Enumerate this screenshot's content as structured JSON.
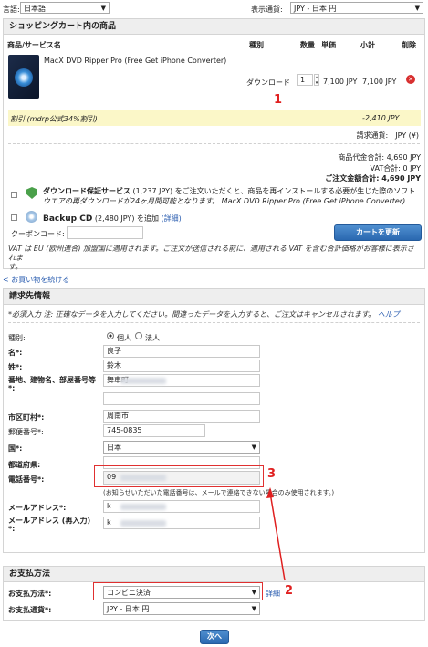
{
  "top": {
    "language_label": "言語:",
    "language_value": "日本語",
    "currency_label": "表示通貨:",
    "currency_value": "JPY - 日本 円"
  },
  "cart": {
    "title": "ショッピングカート内の商品",
    "col_product": "商品/サービス名",
    "col_type": "種別",
    "col_qty": "数量",
    "col_price": "単価",
    "col_subtotal": "小計",
    "col_delete": "削除",
    "product_name": "MacX DVD Ripper Pro (Free Get iPhone Converter)",
    "product_type": "ダウンロード",
    "product_qty": "1",
    "product_price": "7,100 JPY",
    "product_subtotal": "7,100 JPY",
    "discount_label": "割引 (mdrp公式34%割引)",
    "discount_value": "-2,410 JPY",
    "billing_currency": "請求通貨:　JPY (¥)",
    "goods_total": "商品代金合計: 4,690 JPY",
    "vat_total": "VAT合計: 0 JPY",
    "order_total": "ご注文金額合計: 4,690 JPY",
    "download_guarantee_title": "ダウンロード保証サービス",
    "download_guarantee_price": "(1,237 JPY)",
    "download_guarantee_desc1": "をご注文いただくと、商品を再インストールする必要が生じた際のソフト",
    "download_guarantee_desc2": "ウエアの再ダウンロードが24ヶ月間可能となります。 MacX DVD Ripper Pro (Free Get iPhone Converter)",
    "backup_cd_title": "Backup CD",
    "backup_cd_price": "(2,480 JPY)",
    "backup_cd_add": "を追加",
    "backup_cd_detail": "(詳細)",
    "coupon_label": "クーポンコード:",
    "update_button": "カートを更新",
    "vat_note1": "VAT は EU (欧州連合) 加盟国に適用されます。ご注文が送信される前に、適用される VAT を含む合計価格がお客様に表示されま",
    "vat_note2": "す。"
  },
  "continue_shopping": "< お買い物を続ける",
  "billing": {
    "title": "請求先情報",
    "required_note": "*必須入力 注: 正確なデータを入力してください。間違ったデータを入力すると、ご注文はキャンセルされます。",
    "help": "ヘルプ",
    "type_label": "種別:",
    "type_individual": "個人",
    "type_corporate": "法人",
    "first_name_label": "名*:",
    "first_name": "良子",
    "last_name_label": "姓*:",
    "last_name": "鈴木",
    "address_label1": "番地、建物名、部屋番号等",
    "address_label2": "*:",
    "address": "舞車町",
    "city_label": "市区町村*:",
    "city": "周南市",
    "zip_label": "郵便番号*:",
    "zip": "745-0835",
    "country_label": "国*:",
    "country": "日本",
    "prefecture_label": "都道府県:",
    "phone_label": "電話番号*:",
    "phone": "09",
    "phone_note": "(お知らせいただいた電話番号は、メールで連絡できない場合のみ使用されます。)",
    "email_label": "メールアドレス*:",
    "email": "k",
    "email_confirm_label1": "メールアドレス (再入力)",
    "email_confirm_label2": "*:",
    "email_confirm": "k"
  },
  "payment": {
    "title": "お支払方法",
    "method_label": "お支払方法*:",
    "method_value": "コンビニ決済",
    "detail_link": "詳細",
    "currency_label": "お支払通貨*:",
    "currency_value": "JPY - 日本 円"
  },
  "next_button": "次へ",
  "annotations": {
    "a1": "1",
    "a2": "2",
    "a3": "3"
  },
  "colors": {
    "accent": "#2a68b0",
    "annotation": "#e02020",
    "discount_bg": "#fbf7c8"
  }
}
